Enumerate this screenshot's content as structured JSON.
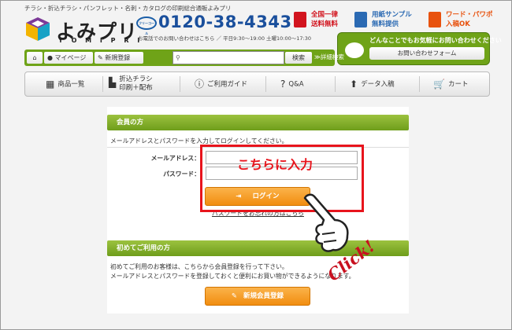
{
  "header": {
    "tagline": "チラシ・折込チラシ・パンフレット・名刺・カタログの印刷総合通販よみプリ",
    "logo_name": "よみプリ",
    "logo_roman": "Y O M I P R I",
    "freedial_label": "フリーコール",
    "phone": "0120-38-4343",
    "phone_note": "お電話でのお問い合わせはこちら ／ 平日9:30〜19:00 土曜10:00〜17:30",
    "promos": [
      {
        "line1": "全国一律",
        "line2": "送料無料",
        "color": "#d2141e",
        "text_color": "#d2141e"
      },
      {
        "line1": "用紙サンプル",
        "line2": "無料提供",
        "color": "#2b6ab3",
        "text_color": "#2b6ab3"
      },
      {
        "line1": "ワード・パワポ",
        "line2": "入稿OK",
        "color": "#e8520e",
        "text_color": "#e8520e"
      }
    ]
  },
  "contact": {
    "title": "どんなことでもお気軽にお問い合わせください",
    "button": "お問い合わせフォーム"
  },
  "user_bar": {
    "mypage": "マイページ",
    "register": "新規登録",
    "search_button": "検索",
    "advanced_search": "≫詳細検索"
  },
  "nav": [
    {
      "label": "商品一覧",
      "icon": "grid-icon"
    },
    {
      "label": "折込チラシ",
      "label2": "印刷＋配布",
      "icon": "factory-icon"
    },
    {
      "label": "ご利用ガイド",
      "icon": "info-icon"
    },
    {
      "label": "Q&A",
      "icon": "question-icon"
    },
    {
      "label": "データ入稿",
      "icon": "upload-icon"
    },
    {
      "label": "カート",
      "icon": "cart-icon"
    }
  ],
  "login": {
    "heading": "会員の方",
    "instruction": "メールアドレスとパスワードを入力してログインしてください。",
    "email_label": "メールアドレス：",
    "password_label": "パスワード：",
    "login_button": "ログイン",
    "forgot_link": "パスワードをお忘れの方はこちら"
  },
  "register": {
    "heading": "初めてご利用の方",
    "line1": "初めてご利用のお客様は、こちらから会員登録を行って下さい。",
    "line2": "メールアドレスとパスワードを登録しておくと便利にお買い物ができるようになります。",
    "button": "新規会員登録"
  },
  "annotations": {
    "enter_here": "こちらに入力",
    "click": "Click!"
  },
  "colors": {
    "brand_green": "#6fa318",
    "accent_orange": "#f18d10",
    "annotation_red": "#e8141c",
    "phone_blue": "#1a4f9c"
  }
}
